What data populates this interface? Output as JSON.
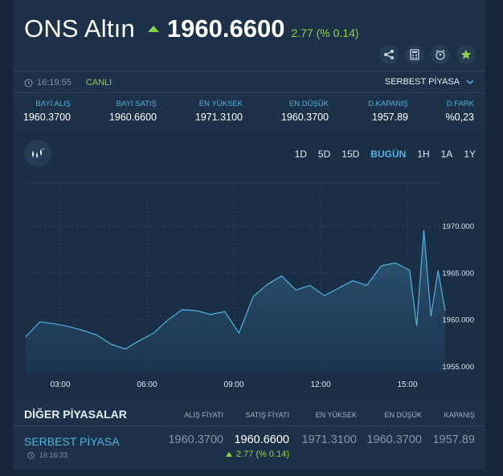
{
  "header": {
    "instrument": "ONS Altın",
    "price": "1960.6600",
    "change": "2.77 (% 0.14)",
    "direction": "up",
    "up_color": "#8bd24a",
    "tool_icons": [
      "share-icon",
      "calculator-icon",
      "alarm-icon",
      "star-icon"
    ]
  },
  "meta": {
    "time": "16:19:55",
    "live_label": "CANLI",
    "market": "SERBEST PİYASA"
  },
  "stats": [
    {
      "label": "BAYİ ALIŞ",
      "value": "1960.3700"
    },
    {
      "label": "BAYİ SATIŞ",
      "value": "1960.6600"
    },
    {
      "label": "EN YÜKSEK",
      "value": "1971.3100"
    },
    {
      "label": "EN DÜŞÜK",
      "value": "1960.3700"
    },
    {
      "label": "D.KAPANIŞ",
      "value": "1957.89"
    },
    {
      "label": "D.FARK",
      "value": "%0,23"
    }
  ],
  "ranges": [
    "1D",
    "5D",
    "15D",
    "BUGÜN",
    "1H",
    "1A",
    "1Y"
  ],
  "active_range": "BUGÜN",
  "chart_data": {
    "type": "area",
    "x_ticks": [
      "03:00",
      "06:00",
      "09:00",
      "12:00",
      "15:00"
    ],
    "y_ticks": [
      "1955.000",
      "1960.000",
      "1965.000",
      "1970.000"
    ],
    "ylim": [
      1955,
      1970
    ],
    "grid": true,
    "x": [
      "01:30",
      "02:00",
      "02:30",
      "03:00",
      "03:30",
      "04:00",
      "04:30",
      "05:00",
      "05:30",
      "06:00",
      "06:30",
      "07:00",
      "07:30",
      "08:00",
      "08:30",
      "09:00",
      "09:30",
      "10:00",
      "10:30",
      "11:00",
      "11:30",
      "12:00",
      "12:30",
      "13:00",
      "13:30",
      "14:00",
      "14:30",
      "15:00",
      "15:15",
      "15:30",
      "15:45",
      "16:00",
      "16:15"
    ],
    "y": [
      1958.2,
      1959.8,
      1959.6,
      1959.3,
      1958.9,
      1958.4,
      1957.4,
      1956.9,
      1957.8,
      1958.6,
      1960.0,
      1961.1,
      1961.0,
      1960.6,
      1960.9,
      1958.6,
      1962.5,
      1963.8,
      1964.7,
      1963.2,
      1963.7,
      1962.6,
      1963.4,
      1964.2,
      1963.7,
      1965.8,
      1966.1,
      1965.3,
      1959.4,
      1969.6,
      1960.4,
      1965.3,
      1961.0
    ],
    "line_color": "#4fb3e0"
  },
  "other_markets": {
    "title": "DİĞER PİYASALAR",
    "columns": [
      "ALIŞ FİYATI",
      "SATIŞ FİYATI",
      "EN YÜKSEK",
      "EN DÜŞÜK",
      "KAPANIŞ"
    ],
    "rows": [
      {
        "name": "SERBEST PİYASA",
        "time": "16:16:33",
        "bid": "1960.3700",
        "ask": "1960.6600",
        "high": "1971.3100",
        "low": "1960.3700",
        "close": "1957.89",
        "change": "2.77 (% 0.14)"
      }
    ]
  }
}
